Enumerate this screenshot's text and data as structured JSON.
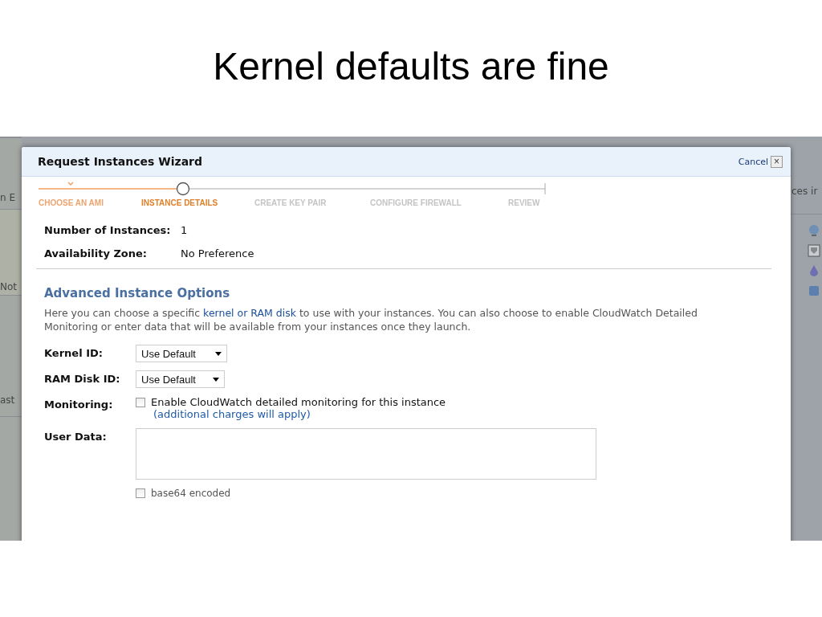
{
  "slide_title": "Kernel defaults are fine",
  "background": {
    "left_fragments": [
      "n E",
      "Not",
      "ast"
    ],
    "right_fragments": [
      "ces ir"
    ]
  },
  "wizard": {
    "title": "Request Instances Wizard",
    "cancel": "Cancel",
    "close": "×",
    "steps": [
      {
        "label": "CHOOSE AN AMI",
        "done": true,
        "selected": false
      },
      {
        "label": "INSTANCE DETAILS",
        "done": false,
        "selected": true
      },
      {
        "label": "CREATE KEY PAIR",
        "done": false,
        "selected": false
      },
      {
        "label": "CONFIGURE FIREWALL",
        "done": false,
        "selected": false
      },
      {
        "label": "REVIEW",
        "done": false,
        "selected": false
      }
    ],
    "summary": [
      {
        "label": "Number of Instances:",
        "value": "1"
      },
      {
        "label": "Availability Zone:",
        "value": "No Preference"
      }
    ],
    "section_title": "Advanced Instance Options",
    "intro": {
      "before": "Here you can choose a specific ",
      "link": "kernel or RAM disk",
      "after": " to use with your instances. You can also choose to enable CloudWatch Detailed Monitoring or enter data that will be available from your instances once they launch."
    },
    "kernel_id": {
      "label": "Kernel ID:",
      "value": "Use Default"
    },
    "ram_disk_id": {
      "label": "RAM Disk ID:",
      "value": "Use Default"
    },
    "monitoring": {
      "label": "Monitoring:",
      "checked": false,
      "text": "Enable CloudWatch detailed monitoring for this instance",
      "note": "(additional charges will apply)"
    },
    "user_data": {
      "label": "User Data:",
      "base64_label": "base64 encoded",
      "base64_checked": false
    }
  }
}
